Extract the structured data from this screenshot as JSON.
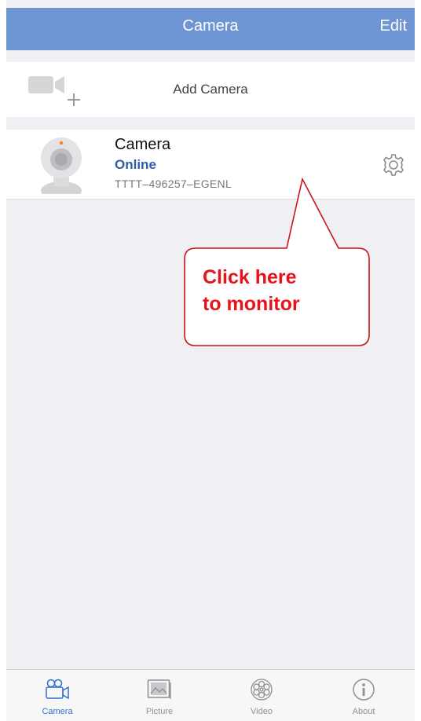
{
  "navbar": {
    "title": "Camera",
    "edit_label": "Edit"
  },
  "add_camera": {
    "label": "Add Camera",
    "icon": "add-video-camera-icon"
  },
  "devices": [
    {
      "name": "Camera",
      "status": "Online",
      "uid": "TTTT–496257–EGENL",
      "thumb_icon": "webcam-icon",
      "settings_icon": "gear-icon"
    }
  ],
  "callout": {
    "line1": "Click here",
    "line2": "to monitor",
    "color": "#e8121a"
  },
  "tabs": [
    {
      "label": "Camera",
      "icon": "camera-tab-icon",
      "active": true
    },
    {
      "label": "Picture",
      "icon": "picture-tab-icon",
      "active": false
    },
    {
      "label": "Video",
      "icon": "video-reel-tab-icon",
      "active": false
    },
    {
      "label": "About",
      "icon": "info-tab-icon",
      "active": false
    }
  ],
  "colors": {
    "navbar": "#6f96d4",
    "status_online": "#2f5ea6",
    "tab_active": "#2f6fd0",
    "background": "#efeff4"
  }
}
